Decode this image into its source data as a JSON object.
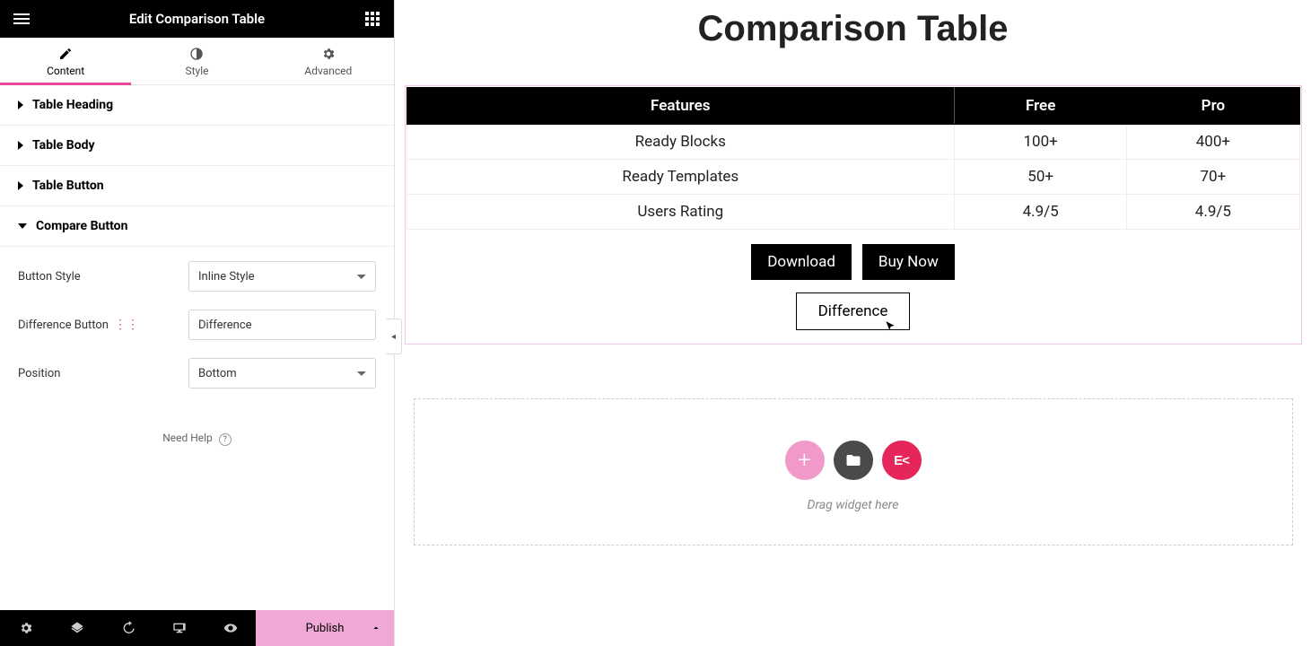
{
  "sidebar": {
    "title": "Edit Comparison Table",
    "tabs": {
      "content": "Content",
      "style": "Style",
      "advanced": "Advanced"
    },
    "sections": {
      "heading": "Table Heading",
      "body": "Table Body",
      "button": "Table Button",
      "compare": "Compare Button"
    },
    "fields": {
      "button_style_label": "Button Style",
      "button_style_value": "Inline Style",
      "diff_button_label": "Difference Button",
      "diff_button_value": "Difference",
      "position_label": "Position",
      "position_value": "Bottom"
    },
    "help": "Need Help",
    "publish": "Publish"
  },
  "canvas": {
    "title": "Comparison Table",
    "table": {
      "headers": [
        "Features",
        "Free",
        "Pro"
      ],
      "rows": [
        [
          "Ready Blocks",
          "100+",
          "400+"
        ],
        [
          "Ready Templates",
          "50+",
          "70+"
        ],
        [
          "Users Rating",
          "4.9/5",
          "4.9/5"
        ]
      ]
    },
    "buttons": {
      "download": "Download",
      "buy": "Buy Now",
      "difference": "Difference"
    },
    "dropzone": {
      "hint": "Drag widget here"
    }
  }
}
